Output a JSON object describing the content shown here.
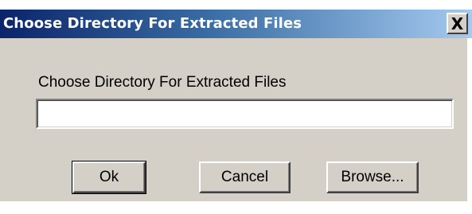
{
  "window": {
    "title": "Choose Directory For Extracted Files",
    "close_glyph": "X",
    "title_gradient_start": "#0a246a",
    "title_gradient_end": "#a6caf0",
    "face_color": "#d4d0c8"
  },
  "form": {
    "prompt_label": "Choose Directory For Extracted Files",
    "directory_value": "",
    "directory_placeholder": ""
  },
  "buttons": {
    "ok_label": "Ok",
    "cancel_label": "Cancel",
    "browse_label": "Browse..."
  },
  "icons": {
    "close": "close-icon"
  }
}
